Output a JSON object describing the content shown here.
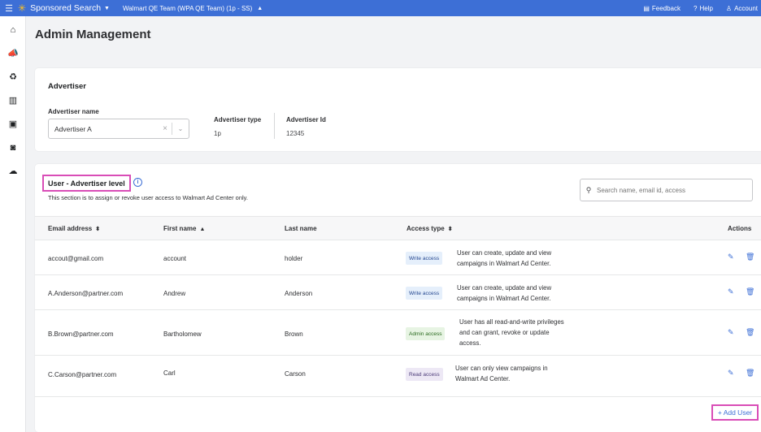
{
  "topbar": {
    "product": "Sponsored Search",
    "team": "Walmart QE Team (WPA QE Team) (1p - SS)",
    "feedback": "Feedback",
    "help": "Help",
    "account": "Account"
  },
  "page": {
    "title": "Admin Management"
  },
  "advertiser": {
    "card_title": "Advertiser",
    "name_label": "Advertiser name",
    "name_value": "Advertiser A",
    "type_label": "Advertiser type",
    "type_value": "1p",
    "id_label": "Advertiser Id",
    "id_value": "12345"
  },
  "users": {
    "section_title": "User - Advertiser level",
    "description": "This section is to assign or revoke user access to Walmart Ad Center only.",
    "search_placeholder": "Search name, email id, access",
    "columns": {
      "email": "Email address",
      "first": "First name",
      "last": "Last name",
      "access": "Access type",
      "actions": "Actions"
    },
    "rows": [
      {
        "email": "accout@gmail.com",
        "first": "account",
        "last": "holder",
        "access": "Write access",
        "access_kind": "write",
        "desc1": "User can create, update and view",
        "desc2": "campaigns in Walmart Ad Center.",
        "desc3": ""
      },
      {
        "email": "A.Anderson@partner.com",
        "first": "Andrew",
        "last": "Anderson",
        "access": "Write access",
        "access_kind": "write",
        "desc1": "User can create, update and view",
        "desc2": "campaigns in Walmart Ad Center.",
        "desc3": ""
      },
      {
        "email": "B.Brown@partner.com",
        "first": "Bartholomew",
        "last": "Brown",
        "access": "Admin access",
        "access_kind": "admin",
        "desc1": "User has all read-and-write privileges",
        "desc2": "and can grant, revoke or update",
        "desc3": "access."
      },
      {
        "email": "C.Carson@partner.com",
        "first": "Carl",
        "last": "Carson",
        "access": "Read access",
        "access_kind": "read",
        "desc1": "User can only view campaigns in",
        "desc2": "Walmart Ad Center.",
        "desc3": ""
      }
    ],
    "add_user": "+ Add User"
  },
  "colors": {
    "brand_blue": "#3d6fd6",
    "highlight_pink": "#d94db7",
    "spark_yellow": "#ffc220"
  }
}
